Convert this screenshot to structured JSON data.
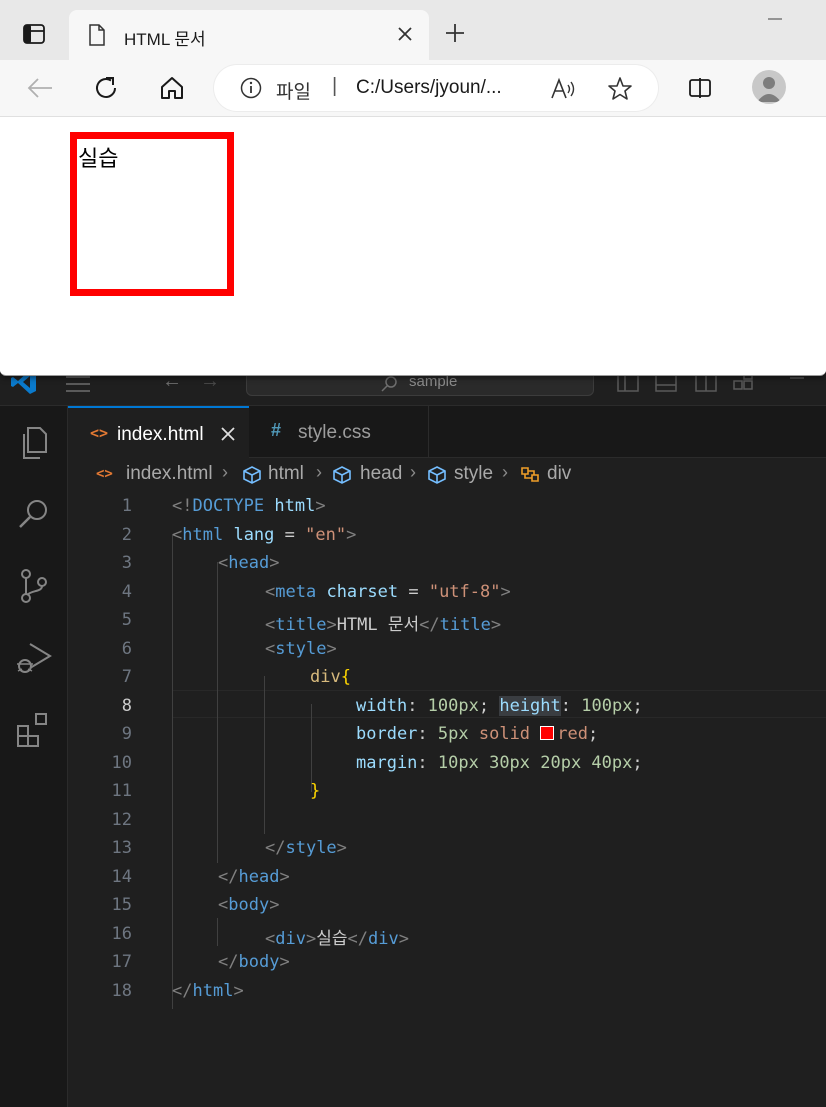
{
  "browser": {
    "tab_title": "HTML 문서",
    "site_label": "파일",
    "separator": "|",
    "url": "C:/Users/jyoun/...",
    "icons": [
      "tab-actions-icon",
      "page-icon",
      "close-icon",
      "plus-icon",
      "back-arrow-icon",
      "reload-icon",
      "home-icon",
      "info-icon",
      "read-aloud-icon",
      "star-icon",
      "split-screen-icon",
      "profile-icon"
    ],
    "page_content": {
      "box_text": "실습",
      "box_border_color": "#ff0000"
    }
  },
  "vscode": {
    "search_placeholder": "sample",
    "tabs": [
      {
        "label": "index.html",
        "icon": "html-file-icon",
        "active": true
      },
      {
        "label": "style.css",
        "icon": "css-hash-icon",
        "active": false
      }
    ],
    "breadcrumb": [
      {
        "label": "index.html",
        "icon": "html-file-icon"
      },
      {
        "label": "html",
        "icon": "cube-icon"
      },
      {
        "label": "head",
        "icon": "cube-icon"
      },
      {
        "label": "style",
        "icon": "cube-icon"
      },
      {
        "label": "div",
        "icon": "selector-icon"
      }
    ],
    "line_numbers": [
      "1",
      "2",
      "3",
      "4",
      "5",
      "6",
      "7",
      "8",
      "9",
      "10",
      "11",
      "12",
      "13",
      "14",
      "15",
      "16",
      "17",
      "18"
    ],
    "active_line": "8",
    "code": {
      "l1": {
        "open": "<!",
        "tag": "DOCTYPE",
        "attr": "html",
        "close": ">"
      },
      "l2": {
        "open": "<",
        "tag": "html",
        "attr": "lang",
        "eq": " = ",
        "str": "\"en\"",
        "close": ">"
      },
      "l3": {
        "open": "<",
        "tag": "head",
        "close": ">"
      },
      "l4": {
        "open": "<",
        "tag": "meta",
        "attr": "charset",
        "eq": " = ",
        "str": "\"utf-8\"",
        "close": ">"
      },
      "l5": {
        "open": "<",
        "tag": "title",
        "close": ">",
        "text": "HTML 문서",
        "open2": "</",
        "tag2": "title",
        "close2": ">"
      },
      "l6": {
        "open": "<",
        "tag": "style",
        "close": ">"
      },
      "l7": {
        "selector": "div",
        "brace": "{"
      },
      "l8": {
        "p1": "width",
        "c1": ": ",
        "v1": "100px",
        "s1": "; ",
        "p2": "height",
        "c2": ": ",
        "v2": "100px",
        "s2": ";"
      },
      "l9": {
        "p": "border",
        "c": ": ",
        "v1": "5px",
        "kw": " solid ",
        "color": "red",
        "s": ";"
      },
      "l10": {
        "p": "margin",
        "c": ": ",
        "v": "10px 30px 20px 40px",
        "s": ";"
      },
      "l11": {
        "brace": "}"
      },
      "l13": {
        "open": "</",
        "tag": "style",
        "close": ">"
      },
      "l14": {
        "open": "</",
        "tag": "head",
        "close": ">"
      },
      "l15": {
        "open": "<",
        "tag": "body",
        "close": ">"
      },
      "l16": {
        "open": "<",
        "tag": "div",
        "close": ">",
        "text": "실습",
        "open2": "</",
        "tag2": "div",
        "close2": ">"
      },
      "l17": {
        "open": "</",
        "tag": "body",
        "close": ">"
      },
      "l18": {
        "open": "</",
        "tag": "html",
        "close": ">"
      }
    },
    "activity_icons": [
      "explorer-icon",
      "search-icon",
      "source-control-icon",
      "run-debug-icon",
      "extensions-icon"
    ],
    "colors": {
      "accent": "#0078d4",
      "tag": "#569cd6",
      "attr": "#9cdcfe",
      "string": "#ce9178",
      "number": "#b5cea8",
      "selector": "#d7ba7d"
    }
  }
}
